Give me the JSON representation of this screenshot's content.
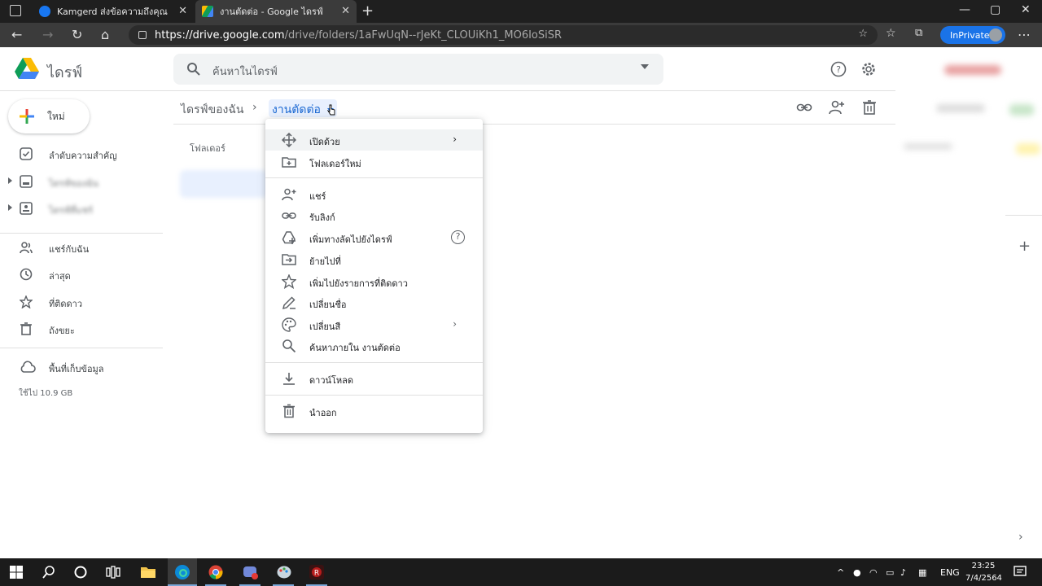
{
  "browser": {
    "tabs": [
      {
        "title": "Kamgerd ส่งข้อความถึงคุณ",
        "favicon": "facebook-icon"
      },
      {
        "title": "งานตัดต่อ - Google ไดรฟ์",
        "favicon": "google-drive-icon"
      }
    ],
    "url_host": "https://drive.google.com",
    "url_path": "/drive/folders/1aFwUqN--rJeKt_CLOUiKh1_MO6IoSiSR",
    "inprivate_label": "InPrivate"
  },
  "drive": {
    "product_name": "ไดรฟ์",
    "search_placeholder": "ค้นหาในไดรฟ์",
    "new_button_label": "ใหม่",
    "sidebar": {
      "items": [
        {
          "label": "ลำดับความสำคัญ",
          "icon": "priority-icon"
        },
        {
          "label": "ไดรฟ์ของฉัน",
          "icon": "my-drive-icon"
        },
        {
          "label": "ไดรฟ์ที่แชร์",
          "icon": "shared-drives-icon"
        },
        {
          "label": "แชร์กับฉัน",
          "icon": "shared-with-me-icon"
        },
        {
          "label": "ล่าสุด",
          "icon": "clock-icon"
        },
        {
          "label": "ที่ติดดาว",
          "icon": "star-icon"
        },
        {
          "label": "ถังขยะ",
          "icon": "trash-icon"
        },
        {
          "label": "พื้นที่เก็บข้อมูล",
          "icon": "cloud-icon"
        }
      ],
      "storage_used": "ใช้ไป 10.9 GB"
    },
    "breadcrumb": {
      "root": "ไดรฟ์ของฉัน",
      "separator": "›",
      "current": "งานตัดต่อ"
    },
    "folders_label": "โฟลเดอร์",
    "context_menu": {
      "items": [
        {
          "label": "เปิดด้วย",
          "icon": "open-with-icon",
          "submenu": true
        },
        {
          "label": "โฟลเดอร์ใหม่",
          "icon": "new-folder-icon"
        },
        {
          "label": "แชร์",
          "icon": "share-icon"
        },
        {
          "label": "รับลิงก์",
          "icon": "link-icon"
        },
        {
          "label": "เพิ่มทางลัดไปยังไดรฟ์",
          "icon": "add-shortcut-icon",
          "help": "?"
        },
        {
          "label": "ย้ายไปที่",
          "icon": "move-to-icon"
        },
        {
          "label": "เพิ่มไปยังรายการที่ติดดาว",
          "icon": "star-icon"
        },
        {
          "label": "เปลี่ยนชื่อ",
          "icon": "rename-icon"
        },
        {
          "label": "เปลี่ยนสี",
          "icon": "palette-icon",
          "submenu": true
        },
        {
          "label": "ค้นหาภายใน งานตัดต่อ",
          "icon": "search-icon"
        },
        {
          "label": "ดาวน์โหลด",
          "icon": "download-icon"
        },
        {
          "label": "นำออก",
          "icon": "trash-icon"
        }
      ]
    }
  },
  "taskbar": {
    "language": "ENG",
    "time": "23:25",
    "date": "7/4/2564"
  },
  "colors": {
    "accent": "#1a73e8",
    "breadcrumb_active_bg": "#e8f0fe",
    "menu_highlight": "#f1f3f4"
  }
}
